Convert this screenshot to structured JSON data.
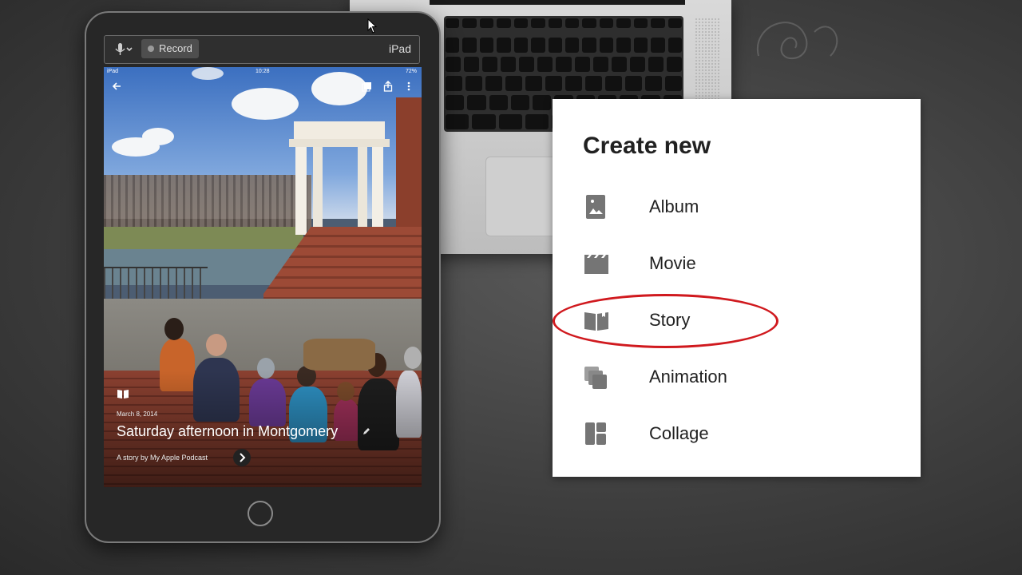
{
  "recorder": {
    "record_label": "Record",
    "device_label": "iPad"
  },
  "ipad_status": {
    "carrier": "iPad",
    "time": "10:28",
    "battery": "72%"
  },
  "story": {
    "date": "March 8, 2014",
    "title": "Saturday afternoon in Montgomery",
    "byline": "A story by My Apple Podcast"
  },
  "create_menu": {
    "title": "Create new",
    "items": [
      {
        "label": "Album",
        "icon": "album-icon"
      },
      {
        "label": "Movie",
        "icon": "movie-icon"
      },
      {
        "label": "Story",
        "icon": "story-icon",
        "highlighted": true
      },
      {
        "label": "Animation",
        "icon": "animation-icon"
      },
      {
        "label": "Collage",
        "icon": "collage-icon"
      }
    ],
    "highlight_color": "#d0191e",
    "icon_color": "#757575"
  }
}
